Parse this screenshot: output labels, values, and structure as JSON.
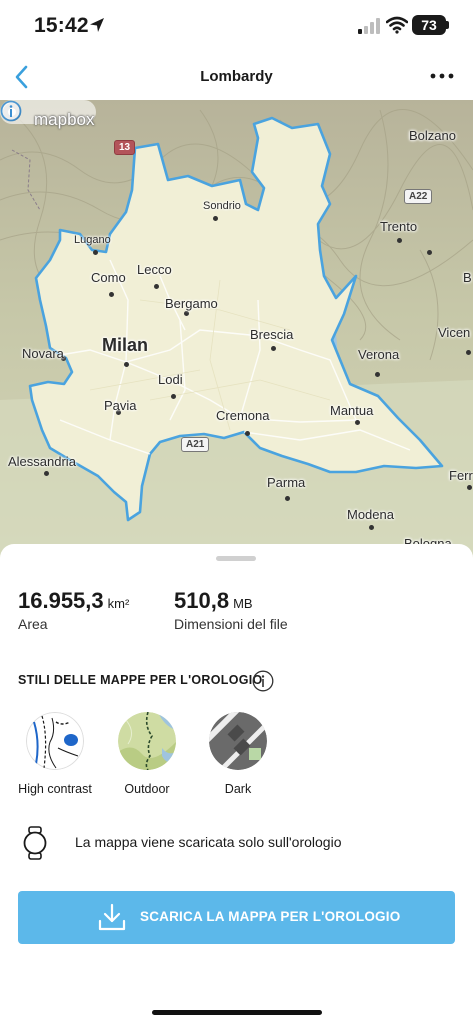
{
  "status_bar": {
    "time": "15:42",
    "battery": "73"
  },
  "nav": {
    "title": "Lombardy"
  },
  "map": {
    "attribution": "mapbox",
    "cities": {
      "bolzano": "Bolzano",
      "sondrio": "Sondrio",
      "trento": "Trento",
      "lugano": "Lugano",
      "como": "Como",
      "lecco": "Lecco",
      "bergamo": "Bergamo",
      "brescia": "Brescia",
      "novara": "Novara",
      "milan": "Milan",
      "verona": "Verona",
      "vicen": "Vicen",
      "lodi": "Lodi",
      "pavia": "Pavia",
      "cremona": "Cremona",
      "mantua": "Mantua",
      "alessandria": "Alessandria",
      "ferr": "Ferr",
      "parma": "Parma",
      "modena": "Modena",
      "bologna": "Bologna",
      "edge_b": "B"
    },
    "roads": {
      "r13": "13",
      "a22": "A22",
      "a21": "A21"
    },
    "colors": {
      "boundary": "#4aa3df",
      "inside": "#f1efd6"
    }
  },
  "stats": {
    "area": {
      "value": "16.955,3",
      "unit": "km²",
      "label": "Area"
    },
    "size": {
      "value": "510,8",
      "unit": "MB",
      "label": "Dimensioni del file"
    }
  },
  "styles_section": {
    "title": "STILI DELLE MAPPE PER L'OROLOGIO",
    "items": [
      {
        "label": "High contrast"
      },
      {
        "label": "Outdoor"
      },
      {
        "label": "Dark"
      }
    ]
  },
  "watch_note": "La mappa viene scaricata solo sull'orologio",
  "download_button": {
    "label": "SCARICA LA MAPPA PER L'OROLOGIO",
    "color": "#5cb8ea"
  },
  "icons": [
    "location-arrow-icon",
    "signal-icon",
    "wifi-icon",
    "back-chevron-icon",
    "more-icon",
    "mapbox-logo-icon",
    "info-icon",
    "watch-icon",
    "download-icon"
  ]
}
